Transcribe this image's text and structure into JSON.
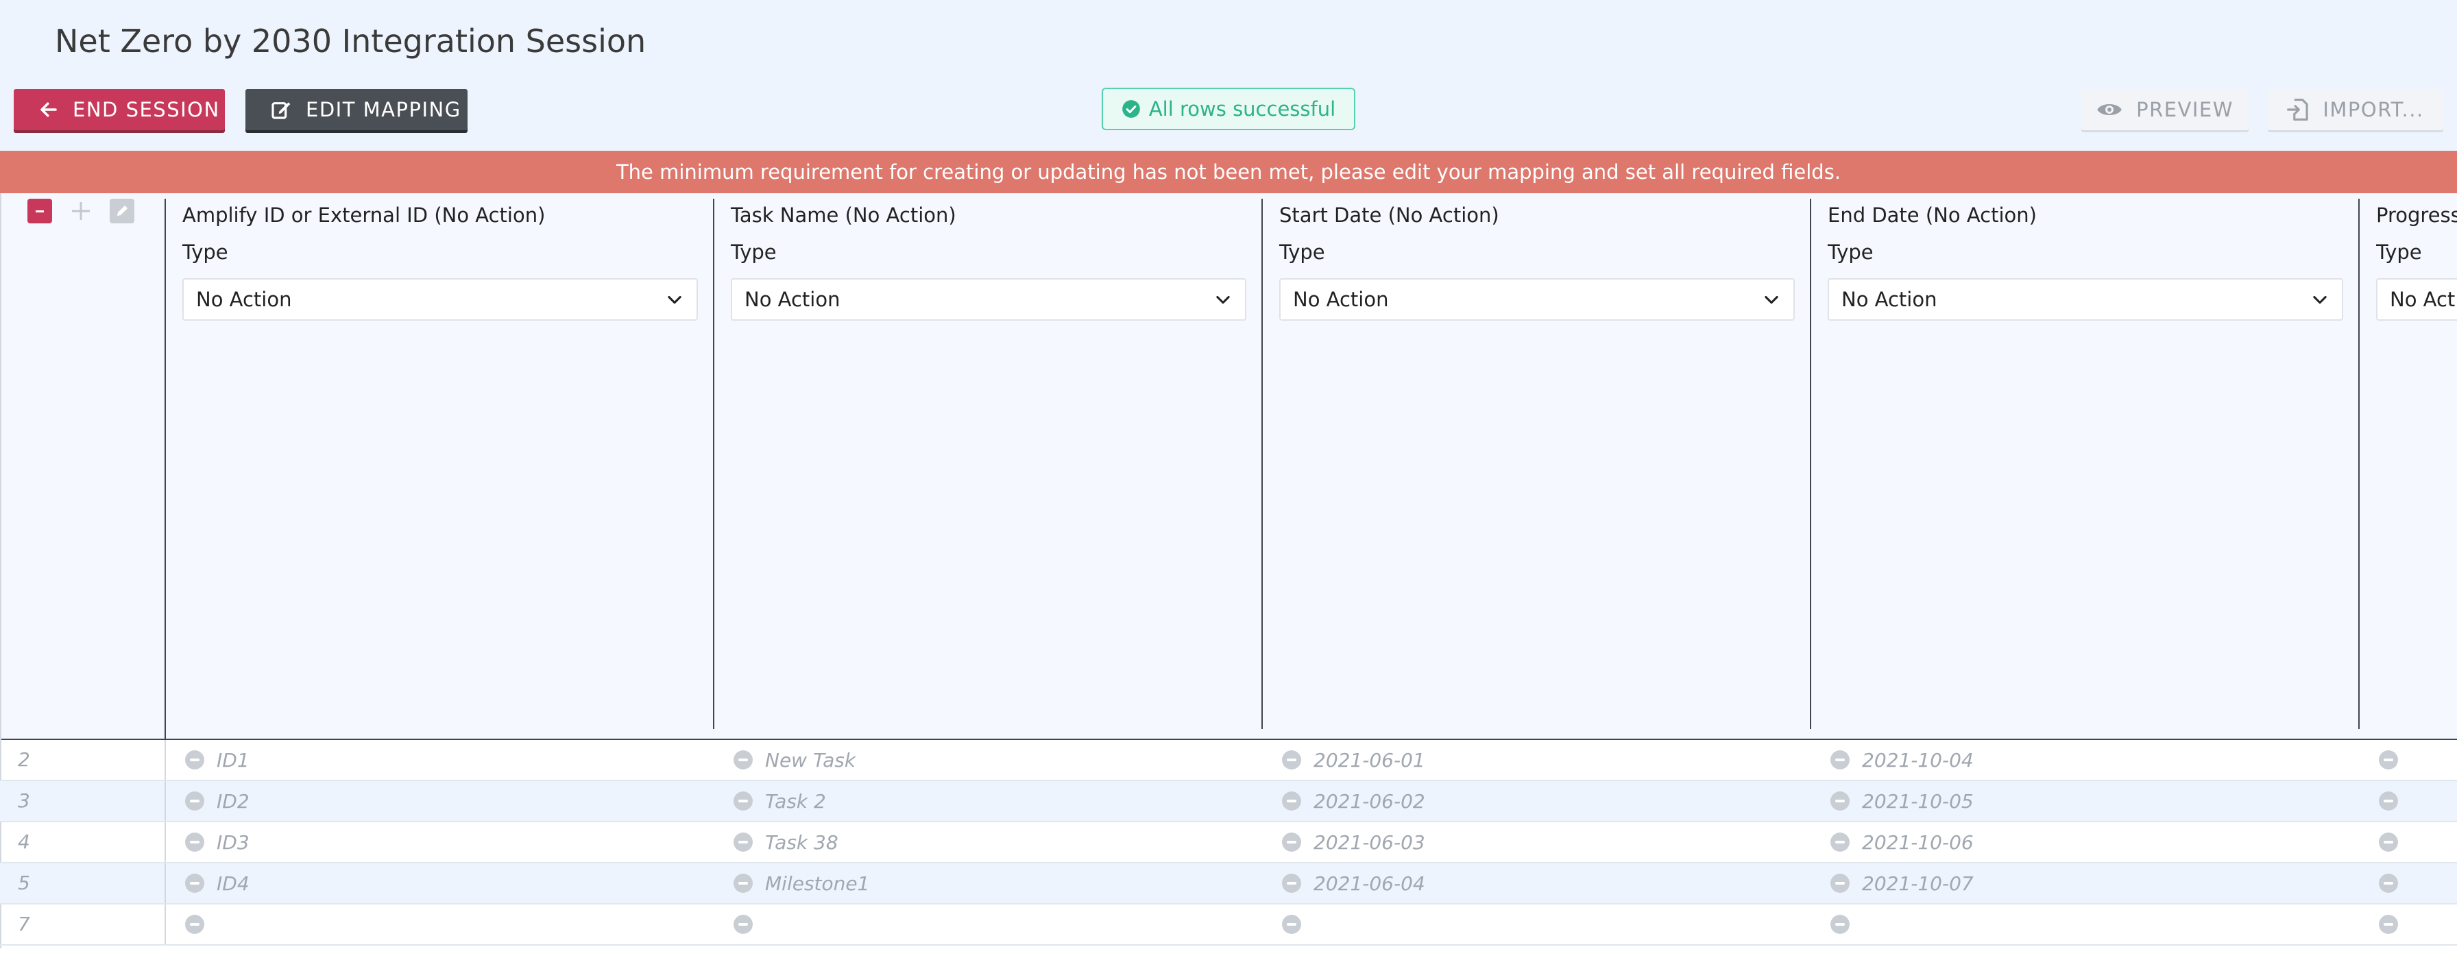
{
  "header": {
    "title": "Net Zero by 2030 Integration Session",
    "end_session_label": "END SESSION",
    "edit_mapping_label": "EDIT MAPPING",
    "status_text": "All rows successful",
    "preview_label": "PREVIEW",
    "import_label": "IMPORT..."
  },
  "banner": {
    "message": "The minimum requirement for creating or updating has not been met, please edit your mapping and set all required fields."
  },
  "grid": {
    "columns": [
      {
        "title": "Amplify ID or External ID (No Action)",
        "type_label": "Type",
        "select_value": "No Action"
      },
      {
        "title": "Task Name (No Action)",
        "type_label": "Type",
        "select_value": "No Action"
      },
      {
        "title": "Start Date (No Action)",
        "type_label": "Type",
        "select_value": "No Action"
      },
      {
        "title": "End Date (No Action)",
        "type_label": "Type",
        "select_value": "No Action"
      },
      {
        "title": "Progress",
        "type_label": "Type",
        "select_value": "No Action"
      }
    ],
    "rows": [
      {
        "num": "2",
        "cells": [
          "ID1",
          "New Task",
          "2021-06-01",
          "2021-10-04",
          ""
        ]
      },
      {
        "num": "3",
        "cells": [
          "ID2",
          "Task 2",
          "2021-06-02",
          "2021-10-05",
          ""
        ]
      },
      {
        "num": "4",
        "cells": [
          "ID3",
          "Task 38",
          "2021-06-03",
          "2021-10-06",
          ""
        ]
      },
      {
        "num": "5",
        "cells": [
          "ID4",
          "Milestone1",
          "2021-06-04",
          "2021-10-07",
          ""
        ]
      },
      {
        "num": "7",
        "cells": [
          "",
          "",
          "",
          "",
          ""
        ]
      }
    ]
  },
  "colors": {
    "danger": "#c8385a",
    "dark_button": "#4a4f56",
    "success": "#2bb389",
    "banner": "#de786d",
    "header_bg": "#eef4fe"
  },
  "icons": {
    "end_session": "arrow-left-icon",
    "edit_mapping": "edit-icon",
    "status": "check-circle-icon",
    "preview": "eye-icon",
    "import": "import-icon",
    "select": "chevron-down-icon",
    "row_status": "minus-circle-icon"
  }
}
